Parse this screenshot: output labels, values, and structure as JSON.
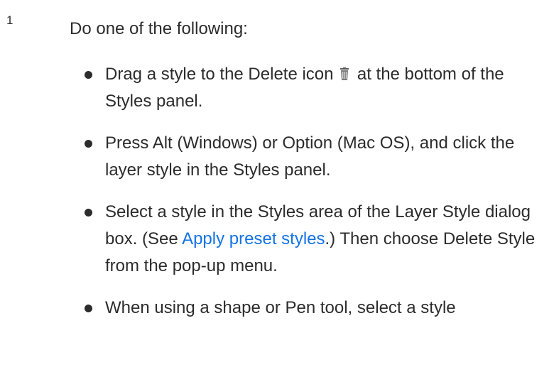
{
  "step": {
    "number": "1",
    "intro": "Do one of the following:"
  },
  "options": [
    {
      "before_icon": "Drag a style to the Delete icon ",
      "icon": "trash-icon",
      "after_icon": " at the bottom of the Styles panel."
    },
    {
      "text": "Press Alt (Windows) or Option (Mac OS), and click the layer style in the Styles panel."
    },
    {
      "before_link": "Select a style in the Styles area of the Layer Style dialog box. (See ",
      "link": "Apply preset styles",
      "after_link": ".) Then choose Delete Style from the pop-up menu."
    },
    {
      "text": "When using a shape or Pen tool, select a style"
    }
  ],
  "colors": {
    "text": "#2c2c2c",
    "link": "#1473e6"
  }
}
